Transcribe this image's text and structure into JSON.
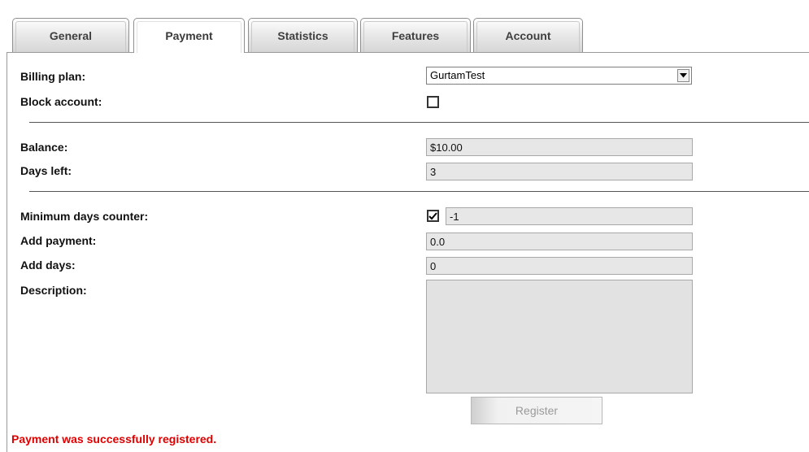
{
  "tabs": [
    {
      "label": "General",
      "active": false
    },
    {
      "label": "Payment",
      "active": true
    },
    {
      "label": "Statistics",
      "active": false
    },
    {
      "label": "Features",
      "active": false
    },
    {
      "label": "Account",
      "active": false
    }
  ],
  "form": {
    "billing_plan": {
      "label": "Billing plan:",
      "value": "GurtamTest"
    },
    "block_account": {
      "label": "Block account:",
      "checked": false
    },
    "balance": {
      "label": "Balance:",
      "value": "$10.00"
    },
    "days_left": {
      "label": "Days left:",
      "value": "3"
    },
    "min_days_counter": {
      "label": "Minimum days counter:",
      "checked": true,
      "value": "-1"
    },
    "add_payment": {
      "label": "Add payment:",
      "value": "0.0"
    },
    "add_days": {
      "label": "Add days:",
      "value": "0"
    },
    "description": {
      "label": "Description:",
      "value": ""
    }
  },
  "register_button": "Register",
  "status_message": "Payment was successfully registered.",
  "icons": {
    "select_arrow": "dropdown-arrow-icon",
    "check": "checkmark-icon"
  },
  "colors": {
    "status": "#e00000"
  }
}
